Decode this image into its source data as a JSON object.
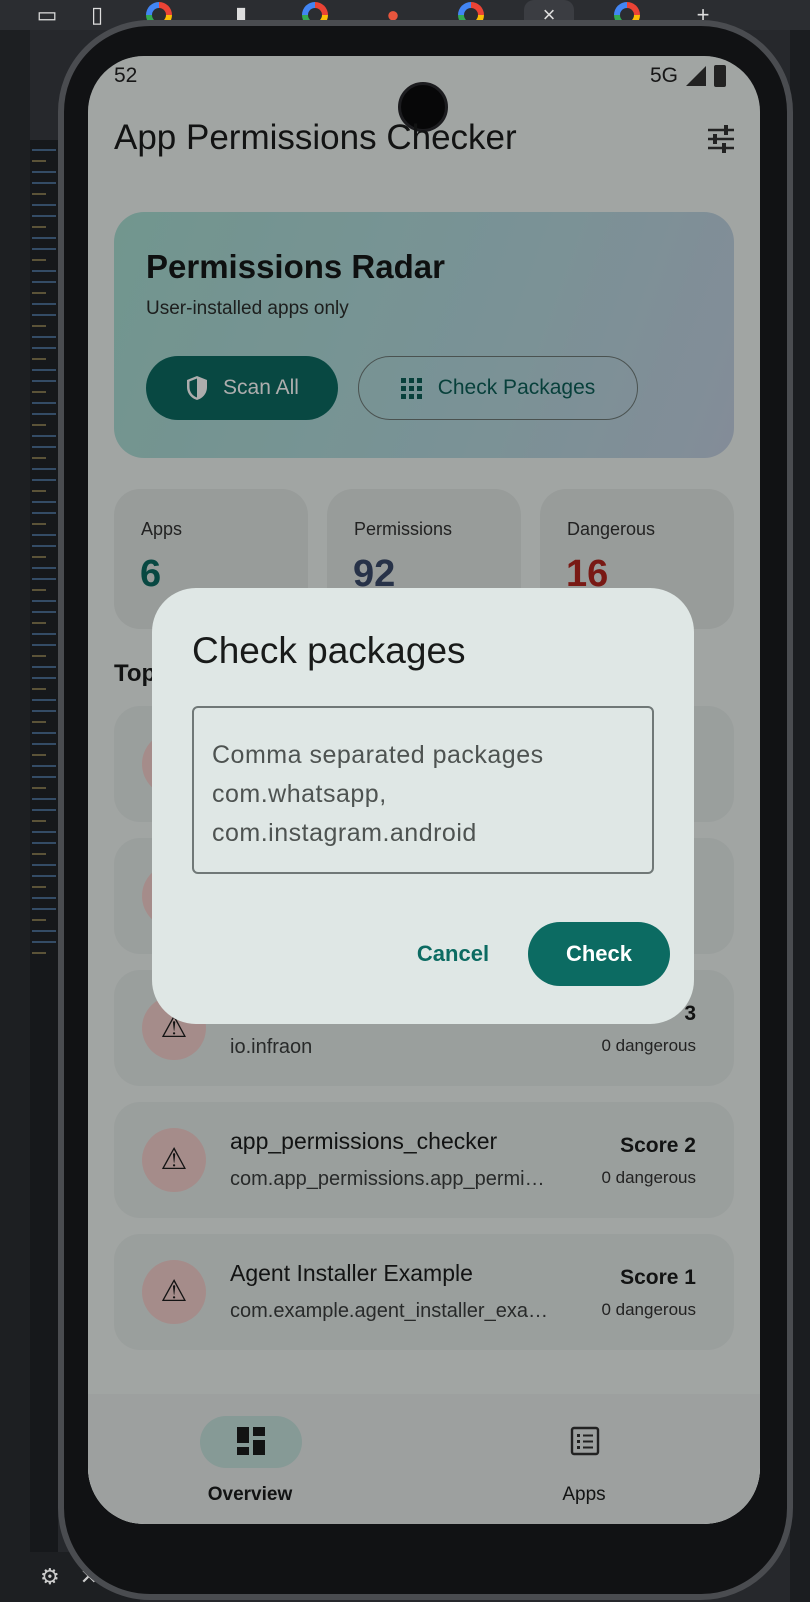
{
  "host": {
    "tab_glyph_x": "×",
    "tab_glyph_plus": "+"
  },
  "status_bar": {
    "time": "52",
    "network": "5G"
  },
  "app": {
    "title": "App Permissions Checker"
  },
  "radar": {
    "title": "Permissions Radar",
    "subtitle": "User-installed apps only",
    "scan_all_label": "Scan All",
    "check_packages_label": "Check Packages"
  },
  "stats": [
    {
      "label": "Apps",
      "value": "6",
      "color": "#0c6b62"
    },
    {
      "label": "Permissions",
      "value": "92",
      "color": "#3a4a6b"
    },
    {
      "label": "Dangerous",
      "value": "16",
      "color": "#b3261e"
    }
  ],
  "section": {
    "title": "Top"
  },
  "list": [
    {
      "name": "",
      "pkg": "io.infraon",
      "score": "3",
      "dangerous": "0 dangerous"
    },
    {
      "name": "app_permissions_checker",
      "pkg": "com.app_permissions.app_permissions_checker",
      "score": "Score 2",
      "dangerous": "0 dangerous"
    },
    {
      "name": "Agent Installer Example",
      "pkg": "com.example.agent_installer_example",
      "score": "Score 1",
      "dangerous": "0 dangerous"
    }
  ],
  "dialog": {
    "title": "Check packages",
    "placeholder": "Comma separated packages com.whatsapp, com.instagram.android",
    "cancel_label": "Cancel",
    "check_label": "Check"
  },
  "nav": {
    "overview_label": "Overview",
    "apps_label": "Apps"
  },
  "colors": {
    "accent": "#0c6b62",
    "danger": "#b3261e"
  }
}
